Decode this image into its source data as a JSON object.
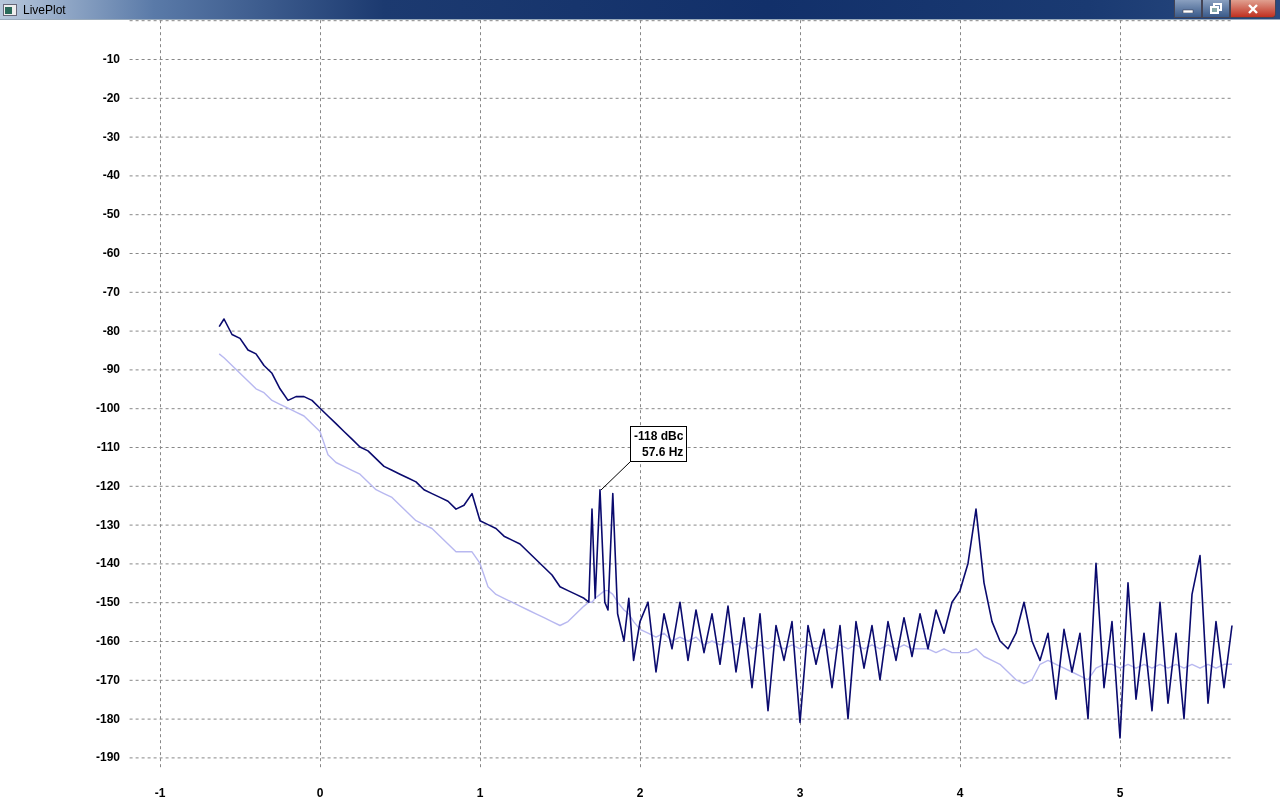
{
  "window": {
    "title": "LivePlot"
  },
  "chart": {
    "chart_data": {
      "type": "line",
      "x": [
        -0.63,
        -0.6,
        -0.55,
        -0.5,
        -0.45,
        -0.4,
        -0.35,
        -0.3,
        -0.25,
        -0.2,
        -0.15,
        -0.1,
        -0.05,
        0,
        0.05,
        0.1,
        0.15,
        0.2,
        0.25,
        0.3,
        0.35,
        0.4,
        0.45,
        0.5,
        0.55,
        0.6,
        0.65,
        0.7,
        0.75,
        0.8,
        0.85,
        0.9,
        0.95,
        1.0,
        1.05,
        1.1,
        1.15,
        1.2,
        1.25,
        1.3,
        1.35,
        1.4,
        1.45,
        1.5,
        1.55,
        1.6,
        1.65,
        1.68,
        1.7,
        1.72,
        1.75,
        1.78,
        1.8,
        1.83,
        1.86,
        1.9,
        1.93,
        1.96,
        2.0,
        2.05,
        2.1,
        2.15,
        2.2,
        2.25,
        2.3,
        2.35,
        2.4,
        2.45,
        2.5,
        2.55,
        2.6,
        2.65,
        2.7,
        2.75,
        2.8,
        2.85,
        2.9,
        2.95,
        3.0,
        3.05,
        3.1,
        3.15,
        3.2,
        3.25,
        3.3,
        3.35,
        3.4,
        3.45,
        3.5,
        3.55,
        3.6,
        3.65,
        3.7,
        3.75,
        3.8,
        3.85,
        3.9,
        3.95,
        4.0,
        4.05,
        4.1,
        4.15,
        4.2,
        4.25,
        4.3,
        4.35,
        4.4,
        4.45,
        4.5,
        4.55,
        4.6,
        4.65,
        4.7,
        4.75,
        4.8,
        4.85,
        4.9,
        4.95,
        5.0,
        5.05,
        5.1,
        5.15,
        5.2,
        5.25,
        5.3,
        5.35,
        5.4,
        5.45,
        5.5,
        5.55,
        5.6,
        5.65,
        5.7
      ],
      "series": [
        {
          "color": "#b8b8f0",
          "values": [
            -86,
            -87,
            -89,
            -91,
            -93,
            -95,
            -96,
            -98,
            -99,
            -100,
            -101,
            -102,
            -104,
            -106,
            -112,
            -114,
            -115,
            -116,
            -117,
            -119,
            -121,
            -122,
            -123,
            -125,
            -127,
            -129,
            -130,
            -131,
            -133,
            -135,
            -137,
            -137,
            -137,
            -140,
            -146,
            -148,
            -149,
            -150,
            -151,
            -152,
            -153,
            -154,
            -155,
            -156,
            -155,
            -153,
            -151,
            -150,
            -150,
            -149,
            -148,
            -147,
            -147,
            -148,
            -150,
            -152,
            -153,
            -155,
            -157,
            -158,
            -159,
            -158,
            -160,
            -159,
            -160,
            -159,
            -161,
            -160,
            -161,
            -160,
            -161,
            -160,
            -162,
            -161,
            -162,
            -161,
            -162,
            -161,
            -162,
            -161,
            -162,
            -161,
            -162,
            -161,
            -162,
            -161,
            -162,
            -161,
            -162,
            -161,
            -162,
            -161,
            -162,
            -162,
            -162,
            -163,
            -162,
            -163,
            -163,
            -163,
            -162,
            -164,
            -165,
            -166,
            -168,
            -170,
            -171,
            -170,
            -166,
            -165,
            -166,
            -167,
            -168,
            -169,
            -170,
            -167,
            -166,
            -166,
            -167,
            -166,
            -167,
            -166,
            -167,
            -166,
            -167,
            -166,
            -167,
            -166,
            -167,
            -166,
            -167,
            -166,
            -166
          ]
        },
        {
          "color": "#0a0a6e",
          "values": [
            -79,
            -77,
            -81,
            -82,
            -85,
            -86,
            -89,
            -91,
            -95,
            -98,
            -97,
            -97,
            -98,
            -100,
            -102,
            -104,
            -106,
            -108,
            -110,
            -111,
            -113,
            -115,
            -116,
            -117,
            -118,
            -119,
            -121,
            -122,
            -123,
            -124,
            -126,
            -125,
            -122,
            -129,
            -130,
            -131,
            -133,
            -134,
            -135,
            -137,
            -139,
            -141,
            -143,
            -146,
            -147,
            -148,
            -149,
            -150,
            -126,
            -149,
            -121,
            -150,
            -152,
            -122,
            -153,
            -160,
            -149,
            -165,
            -155,
            -150,
            -168,
            -153,
            -162,
            -150,
            -165,
            -152,
            -163,
            -153,
            -166,
            -151,
            -168,
            -154,
            -172,
            -153,
            -178,
            -156,
            -165,
            -155,
            -181,
            -156,
            -166,
            -157,
            -172,
            -156,
            -180,
            -155,
            -167,
            -156,
            -170,
            -155,
            -165,
            -154,
            -164,
            -153,
            -162,
            -152,
            -158,
            -150,
            -147,
            -140,
            -126,
            -145,
            -155,
            -160,
            -162,
            -158,
            -150,
            -160,
            -165,
            -158,
            -175,
            -157,
            -168,
            -158,
            -180,
            -140,
            -172,
            -155,
            -185,
            -145,
            -175,
            -158,
            -178,
            -150,
            -176,
            -158,
            -180,
            -148,
            -138,
            -176,
            -155,
            -172,
            -156
          ]
        }
      ],
      "xticks": [
        -1,
        0,
        1,
        2,
        3,
        4,
        5
      ],
      "xlim": [
        -1.19,
        5.7
      ],
      "ylim": [
        -193,
        0
      ],
      "grid": true,
      "yticks": [
        -10,
        -20,
        -30,
        -40,
        -50,
        -60,
        -70,
        -80,
        -90,
        -100,
        -110,
        -120,
        -130,
        -140,
        -150,
        -160,
        -170,
        -180,
        -190
      ],
      "annotations": [
        {
          "text": "-118 dBc\n57.6 Hz"
        }
      ]
    }
  }
}
